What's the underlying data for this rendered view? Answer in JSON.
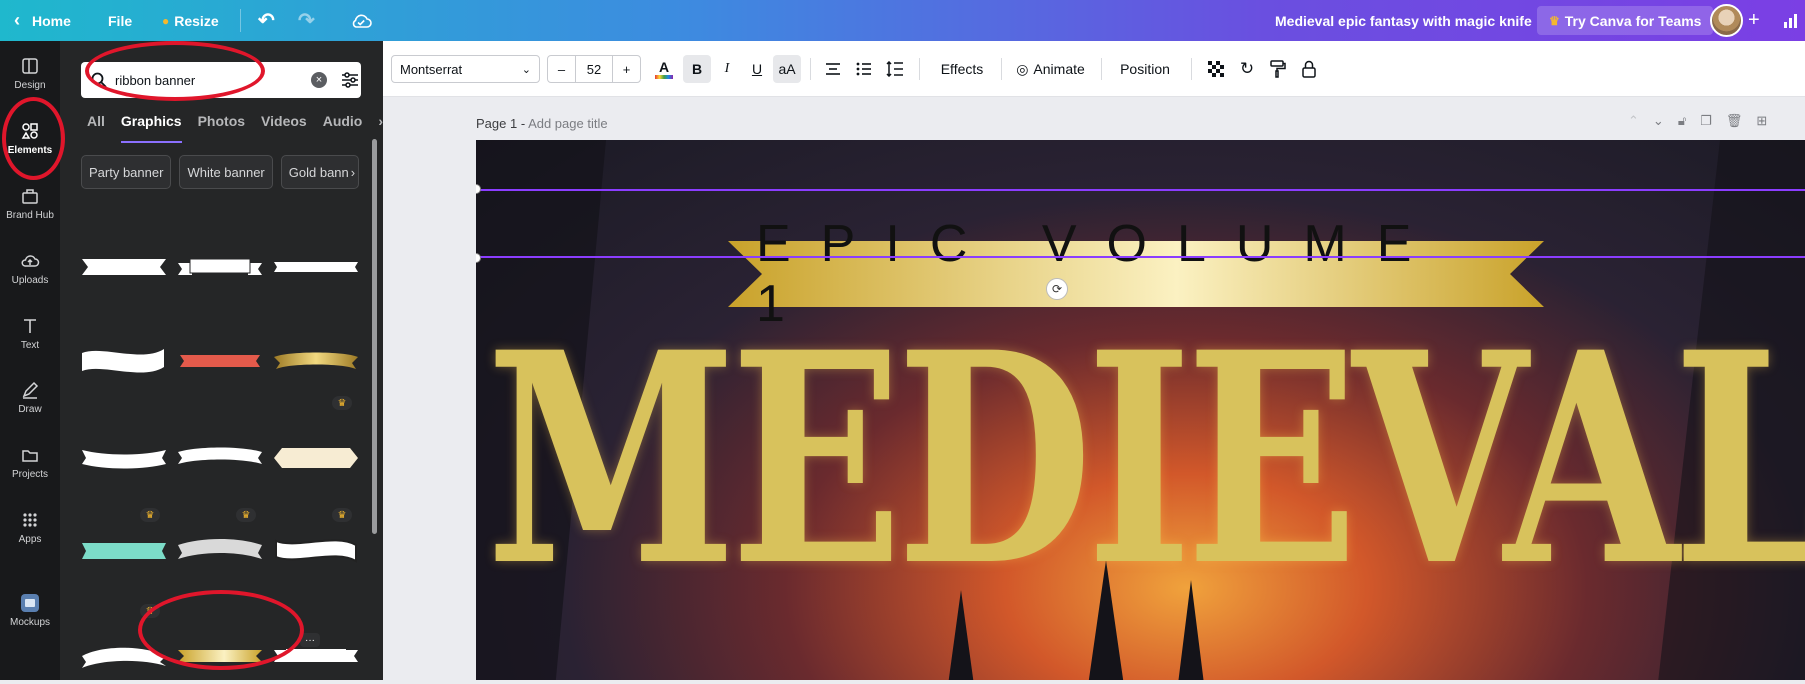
{
  "topbar": {
    "home": "Home",
    "file": "File",
    "resize": "Resize",
    "doc_title": "Medieval epic fantasy with magic knife",
    "teams_cta": "Try Canva for Teams"
  },
  "rail": {
    "items": [
      {
        "label": "Design",
        "icon": "design-icon"
      },
      {
        "label": "Elements",
        "icon": "elements-icon"
      },
      {
        "label": "Brand Hub",
        "icon": "brand-hub-icon"
      },
      {
        "label": "Uploads",
        "icon": "upload-icon"
      },
      {
        "label": "Text",
        "icon": "text-icon"
      },
      {
        "label": "Draw",
        "icon": "draw-icon"
      },
      {
        "label": "Projects",
        "icon": "folder-icon"
      },
      {
        "label": "Apps",
        "icon": "apps-icon"
      },
      {
        "label": "Mockups",
        "icon": "mockups-icon"
      }
    ]
  },
  "panel": {
    "search_value": "ribbon banner",
    "tabs": [
      "All",
      "Graphics",
      "Photos",
      "Videos",
      "Audio"
    ],
    "chips": [
      "Party banner",
      "White banner",
      "Gold bann"
    ]
  },
  "toolbar": {
    "font": "Montserrat",
    "font_size": "52",
    "minus": "–",
    "plus": "+",
    "effects": "Effects",
    "animate": "Animate",
    "position": "Position"
  },
  "workspace": {
    "page_label": "Page 1 -",
    "page_title_placeholder": "Add page title"
  },
  "canvas": {
    "ribbon_text": "EPIC VOLUME 1",
    "headline": "MEDIEVAL"
  },
  "colors": {
    "accent": "#8b3dff",
    "annotation": "#e0162b",
    "gold": "#d8c25c"
  }
}
